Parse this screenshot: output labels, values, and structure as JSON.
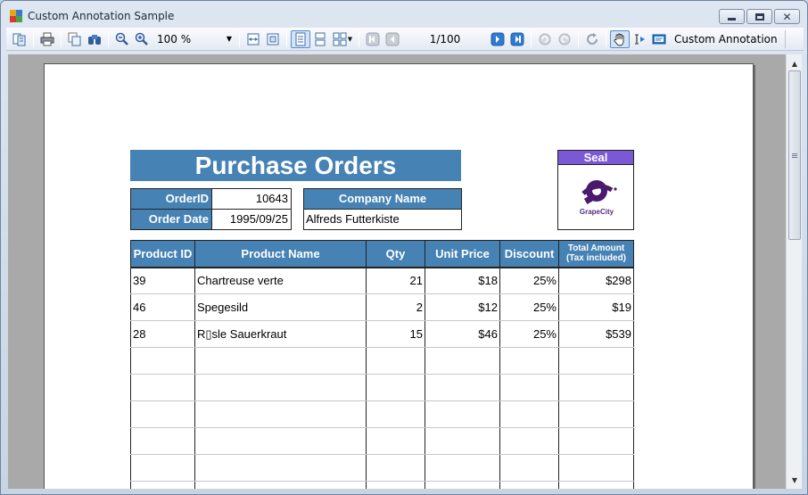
{
  "window": {
    "title": "Custom Annotation Sample"
  },
  "toolbar": {
    "zoom_value": "100 %",
    "page_indicator": "1/100",
    "annotation_label": "Custom Annotation"
  },
  "report": {
    "title": "Purchase Orders",
    "order_id_label": "OrderID",
    "order_id_value": "10643",
    "order_date_label": "Order Date",
    "order_date_value": "1995/09/25",
    "company_label": "Company Name",
    "company_value": "Alfreds Futterkiste",
    "seal_label": "Seal",
    "seal_logo_text": "GrapeCity",
    "columns": [
      "Product ID",
      "Product Name",
      "Qty",
      "Unit Price",
      "Discount",
      "Total Amount\n(Tax included)"
    ],
    "rows": [
      {
        "product_id": "39",
        "product_name": "Chartreuse verte",
        "qty": "21",
        "unit_price": "$18",
        "discount": "25%",
        "total": "$298"
      },
      {
        "product_id": "46",
        "product_name": "Spegesild",
        "qty": "2",
        "unit_price": "$12",
        "discount": "25%",
        "total": "$19"
      },
      {
        "product_id": "28",
        "product_name": "R▯sle Sauerkraut",
        "qty": "15",
        "unit_price": "$46",
        "discount": "25%",
        "total": "$539"
      }
    ]
  },
  "colors": {
    "header_blue": "#4682b4",
    "seal_purple": "#7b59d6",
    "logo_purple": "#5a2a82"
  }
}
